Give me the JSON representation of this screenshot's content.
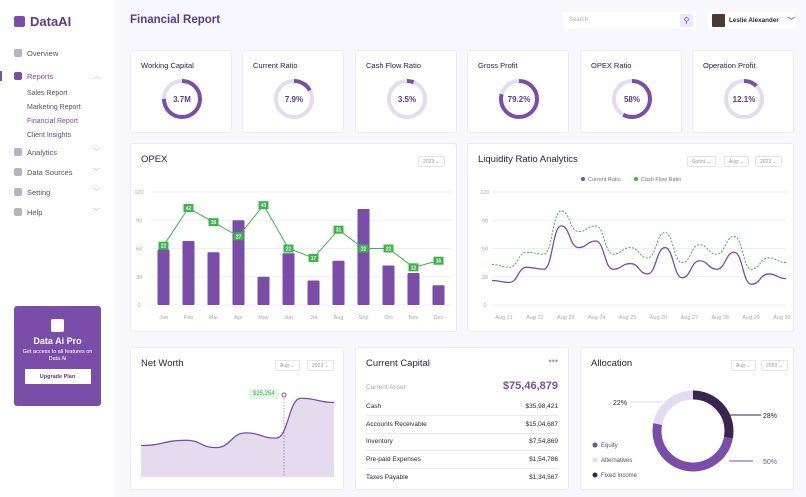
{
  "app": {
    "name": "DataAI"
  },
  "sidebar": {
    "items": [
      {
        "label": "Overview",
        "icon": "home-icon"
      },
      {
        "label": "Reports",
        "icon": "layers-icon",
        "expanded": true,
        "children": [
          "Sales Report",
          "Marketing Report",
          "Financial Report",
          "Client Insights"
        ],
        "active_child": "Financial Report"
      },
      {
        "label": "Analytics",
        "icon": "pie-icon"
      },
      {
        "label": "Data Sources",
        "icon": "database-icon"
      },
      {
        "label": "Setting",
        "icon": "gear-icon"
      },
      {
        "label": "Help",
        "icon": "help-icon"
      }
    ],
    "promo": {
      "title": "Data Ai Pro",
      "text": "Get access to all features on Data Ai",
      "button": "Upgrade Plan"
    }
  },
  "header": {
    "title": "Financial Report",
    "search_placeholder": "Search",
    "user": "Leslie Alexander"
  },
  "colors": {
    "accent": "#7a4ea8",
    "green": "#3bb54a",
    "dark": "#3a2550",
    "light": "#e4dcee"
  },
  "kpis": [
    {
      "label": "Working Capital",
      "value": "3.7M",
      "fill": 0.75
    },
    {
      "label": "Current Ratio",
      "value": "7.9%",
      "fill": 0.17
    },
    {
      "label": "Cash Flow Ratio",
      "value": "3.5%",
      "fill": 0.06
    },
    {
      "label": "Gross Profit",
      "value": "79.2%",
      "fill": 0.792
    },
    {
      "label": "OPEX Ratio",
      "value": "58%",
      "fill": 0.58
    },
    {
      "label": "Operation Profit",
      "value": "12.1%",
      "fill": 0.121
    }
  ],
  "opex": {
    "title": "OPEX",
    "year": "2023"
  },
  "liquidity": {
    "title": "Liquidity Ratio Analytics",
    "filters": [
      "Sprint",
      "Aug",
      "2023"
    ]
  },
  "net_worth": {
    "title": "Net Worth",
    "filters": [
      "Aug",
      "2023"
    ],
    "tooltip": "$25,254"
  },
  "capital": {
    "title": "Current Capital",
    "asset_label": "Current Asset",
    "asset_value": "$75,46,879",
    "rows": [
      {
        "label": "Cash",
        "value": "$35,98,421"
      },
      {
        "label": "Accounts Receivable",
        "value": "$15,04,687"
      },
      {
        "label": "Inventory",
        "value": "$7,54,869"
      },
      {
        "label": "Pre-paid Expenses",
        "value": "$1,54,786"
      },
      {
        "label": "Taxes Payable",
        "value": "$1,34,567"
      }
    ]
  },
  "allocation": {
    "title": "Allocation",
    "filters": [
      "Aug",
      "2023"
    ]
  },
  "chart_data": [
    {
      "type": "bar",
      "title": "OPEX",
      "categories": [
        "Jan",
        "Feb",
        "Mar",
        "Apr",
        "May",
        "Jun",
        "Jul",
        "Aug",
        "Sep",
        "Oct",
        "Nov",
        "Dec"
      ],
      "values": [
        59,
        68,
        56,
        90,
        30,
        55,
        26,
        47,
        102,
        42,
        34,
        21
      ],
      "line": {
        "points": [
          63,
          103,
          88,
          73,
          106,
          60,
          50,
          80,
          60,
          60,
          40,
          47
        ],
        "labels": [
          "22",
          "42",
          "35",
          "27",
          "43",
          "22",
          "17",
          "31",
          "22",
          "22",
          "12",
          "16"
        ]
      },
      "yticks": [
        0,
        30,
        60,
        90,
        120
      ],
      "ylim": [
        0,
        120
      ],
      "grid": true
    },
    {
      "type": "line",
      "title": "Liquidity Ratio Analytics",
      "categories": [
        "Aug 21",
        "Aug 22",
        "Aug 23",
        "Aug 24",
        "Aug 25",
        "Aug 26",
        "Aug 27",
        "Aug 28",
        "Aug 29",
        "Aug 30"
      ],
      "series": [
        {
          "name": "Current Ratio",
          "values": [
            26,
            24,
            40,
            38,
            84,
            61,
            68,
            38,
            44,
            33,
            61,
            29,
            47,
            38,
            56,
            22,
            33,
            28
          ]
        },
        {
          "name": "Cash Flow Ratio",
          "values": [
            43,
            40,
            56,
            54,
            100,
            78,
            84,
            54,
            61,
            50,
            77,
            45,
            64,
            54,
            73,
            38,
            50,
            45
          ]
        }
      ],
      "yticks": [
        0,
        30,
        60,
        90,
        120
      ],
      "ylim": [
        0,
        120
      ],
      "legend": "top",
      "grid": true
    },
    {
      "type": "area",
      "title": "Net Worth",
      "values": [
        30,
        35,
        28,
        42,
        37,
        75,
        71
      ]
    },
    {
      "type": "pie",
      "title": "Allocation",
      "slices": [
        {
          "name": "Fixed Income",
          "value": 28,
          "label": "28%"
        },
        {
          "name": "Equity",
          "value": 50,
          "label": "50%"
        },
        {
          "name": "Alternatives",
          "value": 22,
          "label": "22%"
        }
      ]
    }
  ]
}
